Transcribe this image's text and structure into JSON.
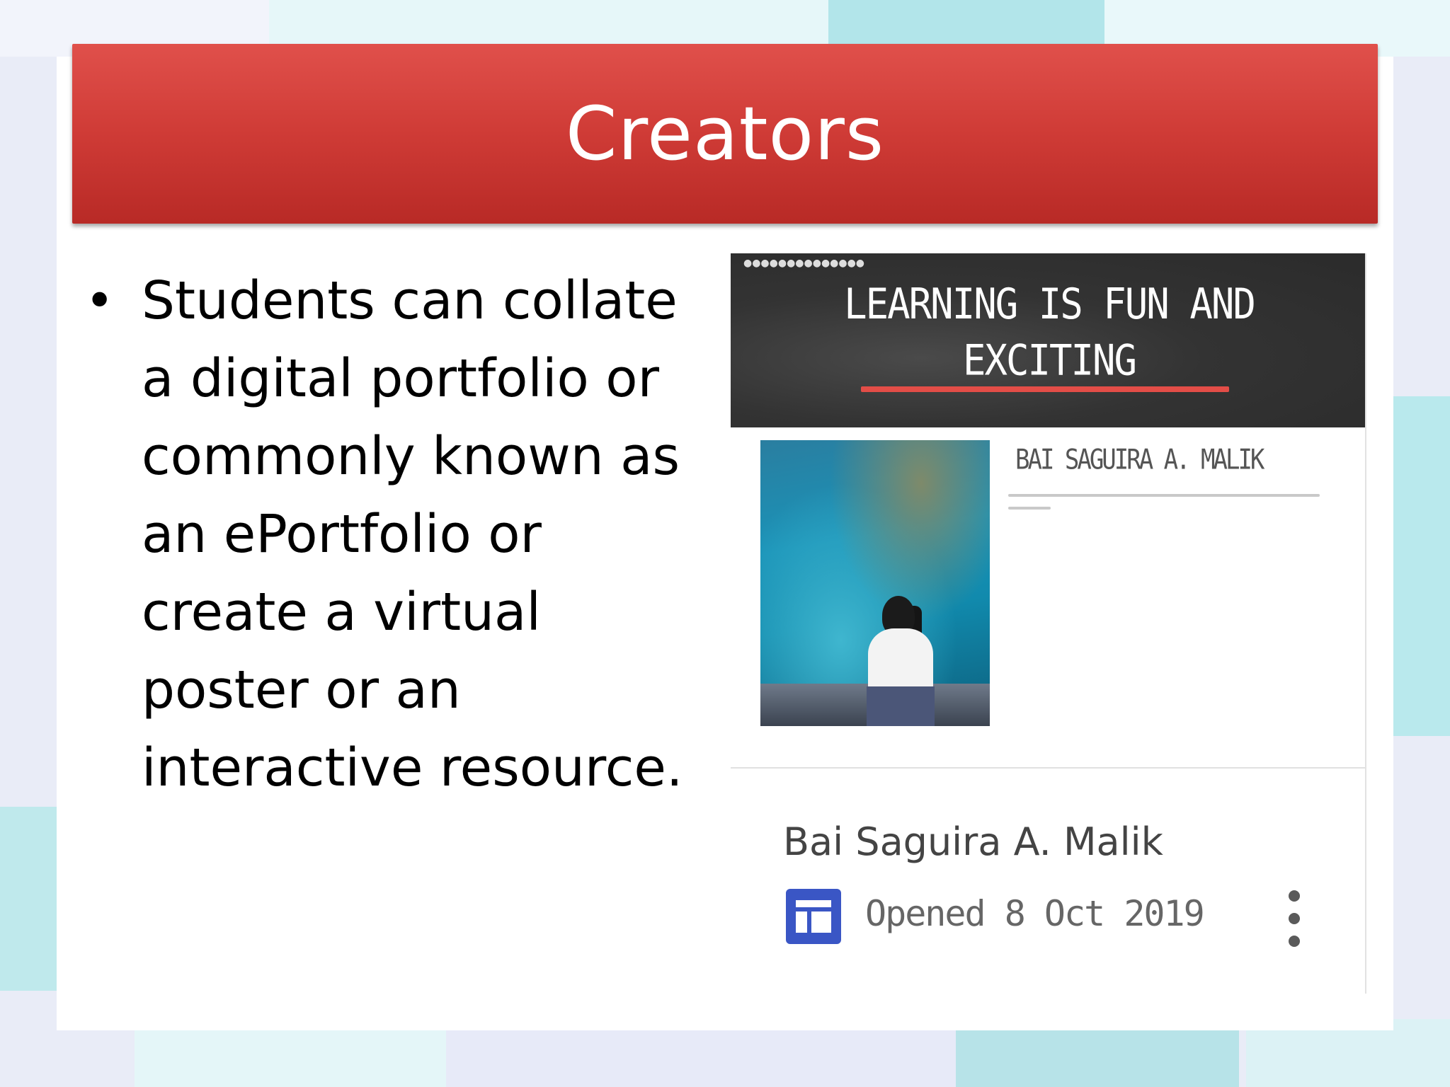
{
  "slide": {
    "title": "Creators",
    "bullet": "Students can collate a digital portfolio or commonly known as an ePortfolio or create a virtual poster or an interactive resource."
  },
  "card": {
    "header_headline": "LEARNING IS FUN AND EXCITING",
    "profile_name": "BAI SAGUIRA A. MALIK",
    "title": "Bai Saguira A. Malik",
    "opened": "Opened 8 Oct 2019",
    "doc_icon": "sites-layout-icon",
    "menu_icon": "more-vert-icon"
  },
  "colors": {
    "title_bar": "#cf3b36",
    "accent_rule": "#e34d47",
    "doc_icon": "#3a56c5"
  }
}
